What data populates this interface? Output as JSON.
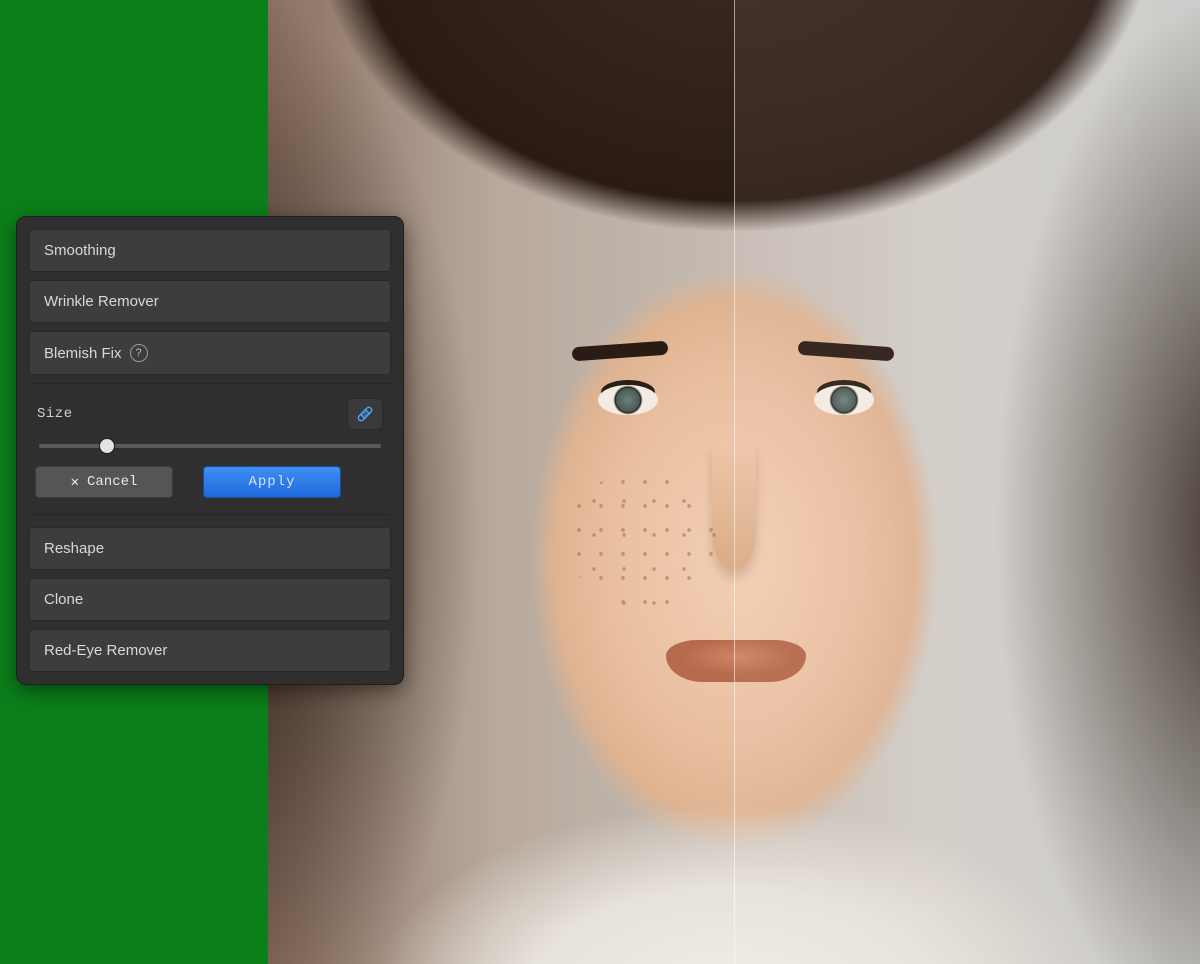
{
  "panel": {
    "tools": [
      {
        "label": "Smoothing"
      },
      {
        "label": "Wrinkle Remover"
      },
      {
        "label": "Blemish Fix",
        "help": "?"
      },
      {
        "label": "Reshape"
      },
      {
        "label": "Clone"
      },
      {
        "label": "Red-Eye Remover"
      }
    ],
    "expanded": {
      "size_label": "Size",
      "slider_percent": 20,
      "cancel_label": "Cancel",
      "apply_label": "Apply",
      "tool_icon": "bandage"
    }
  },
  "canvas": {
    "divider": "before-after",
    "colors": {
      "backdrop": "#0b7f1a",
      "panel_bg": "#2f2f2f",
      "accent_blue": "#2d7ae5"
    }
  }
}
